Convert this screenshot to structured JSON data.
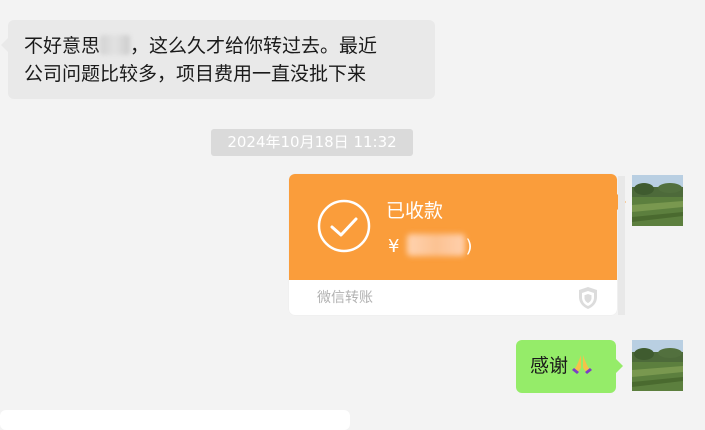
{
  "incoming_message": {
    "text_part1": "不好意思",
    "text_part2": "，这么久才给你转过去。最近",
    "text_line2": "公司问题比较多，项目费用一直没批下来"
  },
  "timestamp": "2024年10月18日 11:32",
  "transfer_card": {
    "status": "已收款",
    "currency_symbol": "¥",
    "amount_tail": ")",
    "footer_label": "微信转账",
    "accent_color": "#fa9d3b",
    "icons": [
      "check-circle-icon",
      "shield-icon"
    ]
  },
  "outgoing_message": {
    "text": "感谢",
    "emoji": "pray-icon",
    "bubble_color": "#95ec69"
  }
}
